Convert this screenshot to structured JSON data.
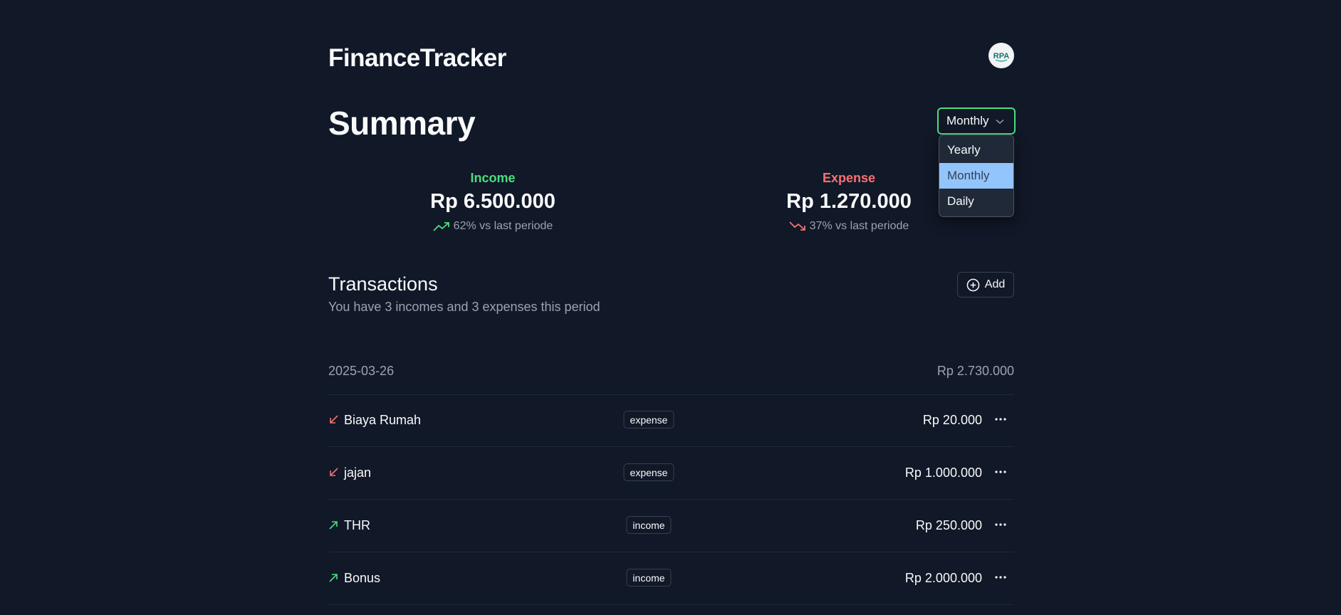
{
  "app": {
    "title": "FinanceTracker",
    "avatar_icon": "rpa-logo-avatar"
  },
  "summary": {
    "title": "Summary",
    "period_selected": "Monthly",
    "period_options": [
      "Yearly",
      "Monthly",
      "Daily"
    ],
    "income": {
      "label": "Income",
      "amount": "Rp 6.500.000",
      "change": "62% vs last periode",
      "trend_icon": "trending-up-icon",
      "color": "#4ade80"
    },
    "expense": {
      "label": "Expense",
      "amount": "Rp 1.270.000",
      "change": "37% vs last periode",
      "trend_icon": "trending-down-icon",
      "color": "#f87171"
    }
  },
  "transactions": {
    "title": "Transactions",
    "subtitle": "You have 3 incomes and 3 expenses this period",
    "add_label": "Add",
    "group": {
      "date": "2025-03-26",
      "total": "Rp 2.730.000"
    },
    "items": [
      {
        "name": "Biaya Rumah",
        "type": "expense",
        "amount": "Rp 20.000"
      },
      {
        "name": "jajan",
        "type": "expense",
        "amount": "Rp 1.000.000"
      },
      {
        "name": "THR",
        "type": "income",
        "amount": "Rp 250.000"
      },
      {
        "name": "Bonus",
        "type": "income",
        "amount": "Rp 2.000.000"
      }
    ]
  },
  "colors": {
    "background": "#111827",
    "accent_green": "#4ade80",
    "accent_red": "#f87171",
    "selected_option": "#93c5fd"
  }
}
